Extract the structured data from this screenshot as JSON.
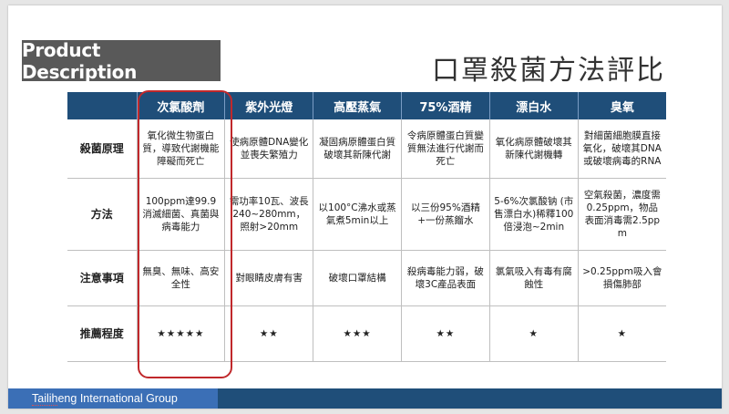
{
  "slide": {
    "label": "Product Description",
    "title": "口罩殺菌方法評比",
    "footer": "Tailiheng International Group"
  },
  "table": {
    "headers": [
      "",
      "次氯酸劑",
      "紫外光燈",
      "高壓蒸氣",
      "75%酒精",
      "漂白水",
      "臭氧"
    ],
    "rows": [
      {
        "label": "殺菌原理",
        "cells": [
          "氧化微生物蛋白質，導致代謝機能障礙而死亡",
          "使病原體DNA變化並喪失繁殖力",
          "凝固病原體蛋白質破壞其新陳代謝",
          "令病原體蛋白質變質無法進行代謝而死亡",
          "氧化病原體破壞其新陳代謝機轉",
          "對細菌細胞膜直接氧化，破壞其DNA或破壞病毒的RNA"
        ]
      },
      {
        "label": "方法",
        "cells": [
          "100ppm達99.9消滅細菌、真菌與病毒能力",
          "需功率10瓦、波長240~280mm，照射>20mm",
          "以100°C沸水或蒸氣煮5min以上",
          "以三份95%酒精+一份蒸餾水",
          "5-6%次氯酸钠 (市售漂白水)稀釋100倍浸泡~2min",
          "空氣殺菌，濃度需0.25ppm，物品表面消毒需2.5ppm"
        ]
      },
      {
        "label": "注意事項",
        "cells": [
          "無臭、無味、高安全性",
          "對眼睛皮膚有害",
          "破壞口罩結構",
          "殺病毒能力弱，破壞3C產品表面",
          "氯氣吸入有毒有腐蝕性",
          ">0.25ppm吸入會損傷肺部"
        ]
      },
      {
        "label": "推薦程度",
        "cells": [
          "★★★★★",
          "★★",
          "★★★",
          "★★",
          "★",
          "★"
        ]
      }
    ]
  },
  "colors": {
    "header_bg": "#1f4e79",
    "label_bg": "#595959",
    "star": "#f5c400",
    "highlight": "#c0282b"
  }
}
